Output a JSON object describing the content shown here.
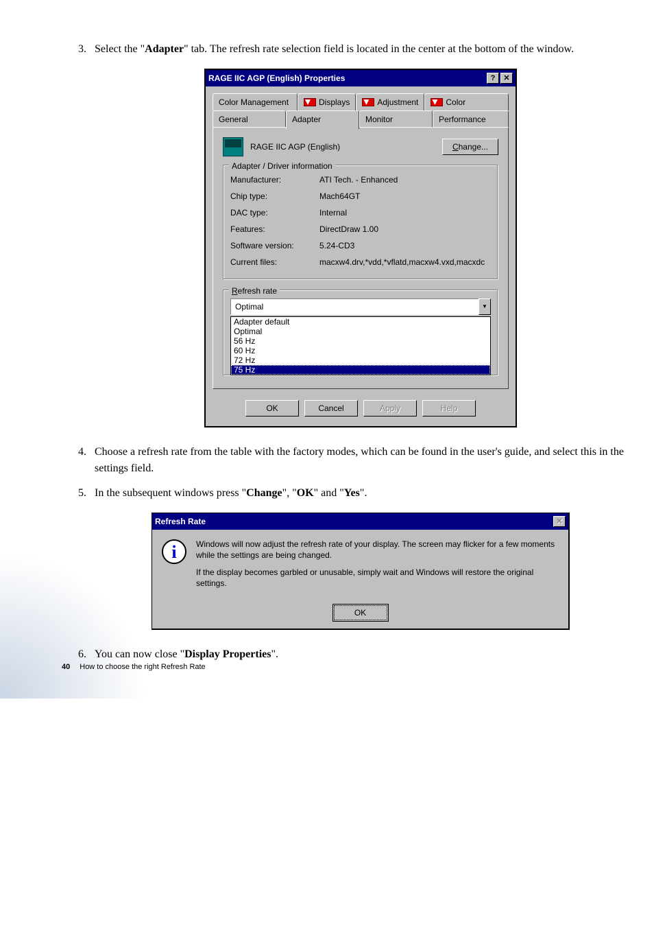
{
  "steps": {
    "s3_a": "Select the \"",
    "s3_b": "Adapter",
    "s3_c": "\" tab. The refresh rate selection field is located in the center at the bottom of the window.",
    "s4": "Choose a refresh rate from the table with the factory modes, which can be found in the user's guide, and select this in the settings field.",
    "s5_a": "In the subsequent windows press \"",
    "s5_b": "Change",
    "s5_c": "\", \"",
    "s5_d": "OK",
    "s5_e": "\" and \"",
    "s5_f": "Yes",
    "s5_g": "\".",
    "s6_a": "You can now close \"",
    "s6_b": "Display Properties",
    "s6_c": "\"."
  },
  "dialog": {
    "title": "RAGE IIC AGP (English) Properties",
    "help_glyph": "?",
    "close_glyph": "✕",
    "tabs_top": {
      "color_management": "Color Management",
      "displays": "Displays",
      "adjustment": "Adjustment",
      "color": "Color"
    },
    "tabs_bottom": {
      "general": "General",
      "adapter": "Adapter",
      "monitor": "Monitor",
      "performance": "Performance"
    },
    "adapter_name": "RAGE IIC AGP (English)",
    "change_btn": "hange...",
    "change_btn_u": "C",
    "group_driver": "Adapter / Driver information",
    "info": {
      "manufacturer_l": "Manufacturer:",
      "manufacturer_v": "ATI Tech. - Enhanced",
      "chip_l": "Chip type:",
      "chip_v": "Mach64GT",
      "dac_l": "DAC type:",
      "dac_v": "Internal",
      "features_l": "Features:",
      "features_v": "DirectDraw 1.00",
      "sw_l": "Software version:",
      "sw_v": "5.24-CD3",
      "files_l": "Current files:",
      "files_v": "macxw4.drv,*vdd,*vflatd,macxw4.vxd,macxdc"
    },
    "group_refresh": "efresh rate",
    "group_refresh_u": "R",
    "dropdown_value": "Optimal",
    "dropdown_arrow": "▼",
    "options": [
      "Adapter default",
      "Optimal",
      "56 Hz",
      "60 Hz",
      "72 Hz",
      "75 Hz"
    ],
    "buttons": {
      "ok": "OK",
      "cancel": "Cancel",
      "apply": "Apply",
      "help": "Help"
    }
  },
  "msgbox": {
    "title": "Refresh Rate",
    "icon": "i",
    "close_glyph": "✕",
    "p1": "Windows will now adjust the refresh rate of your display.  The screen may flicker for a few moments while the settings are being changed.",
    "p2": "If the display becomes garbled or unusable, simply wait and Windows will restore the original settings.",
    "ok": "OK"
  },
  "footer": {
    "page_num": "40",
    "text": "How to choose the right Refresh Rate"
  }
}
